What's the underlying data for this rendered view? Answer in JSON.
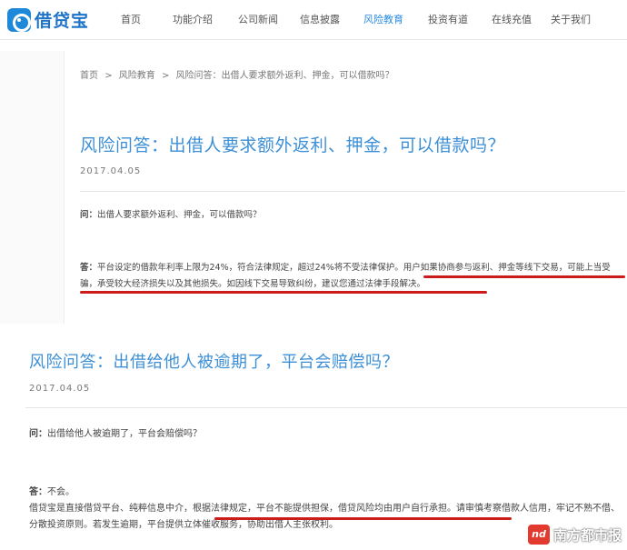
{
  "header": {
    "logo_text": "借贷宝",
    "nav": [
      {
        "label": "首页",
        "active": false
      },
      {
        "label": "功能介绍",
        "active": false
      },
      {
        "label": "公司新闻",
        "active": false
      },
      {
        "label": "信息披露",
        "active": false
      },
      {
        "label": "风险教育",
        "active": true
      },
      {
        "label": "投资有道",
        "active": false
      },
      {
        "label": "在线充值",
        "active": false
      },
      {
        "label": "关于我们",
        "active": false
      }
    ]
  },
  "breadcrumb": [
    "首页",
    ">",
    "风险教育",
    ">",
    "风险问答：出借人要求额外返利、押金，可以借款吗？"
  ],
  "article1": {
    "title": "风险问答：出借人要求额外返利、押金，可以借款吗？",
    "date": "2017.04.05",
    "q_label": "问：",
    "question": "出借人要求额外返利、押金，可以借款吗？",
    "a_label": "答：",
    "answer_part1": "平台设定的借款年利率上限为24%，符合法律规定，超过24%将不受法律保护。",
    "answer_part2": "用户如果协商参与返利、押金等线下交易，可能上当受骗，承受较大经济损失以及其他损失。如因线下交易导致纠纷，建议您通过法律手段解决。"
  },
  "article2": {
    "title": "风险问答：出借给他人被逾期了，平台会赔偿吗？",
    "date": "2017.04.05",
    "q_label": "问：",
    "question": "出借给他人被逾期了，平台会赔偿吗？",
    "a_label": "答：",
    "answer_line1": "不会。",
    "answer_part1": "借贷宝是直接借贷平台、纯粹信息中介，",
    "answer_part2": "根据法律规定，平台不能提供担保，借贷风险均由用户自行承担。",
    "answer_part3": "请审慎考察借款人信用，牢记不熟不借、分散投资原则。若发生逾期，平台提供立体催收服务，协助出借人主张权利。"
  },
  "watermark": {
    "logo": "nd",
    "text": "南方都市报"
  },
  "colors": {
    "brand_blue": "#1e88d9",
    "title_blue": "#3d8fd6",
    "underline_red": "#cc1b1b"
  }
}
